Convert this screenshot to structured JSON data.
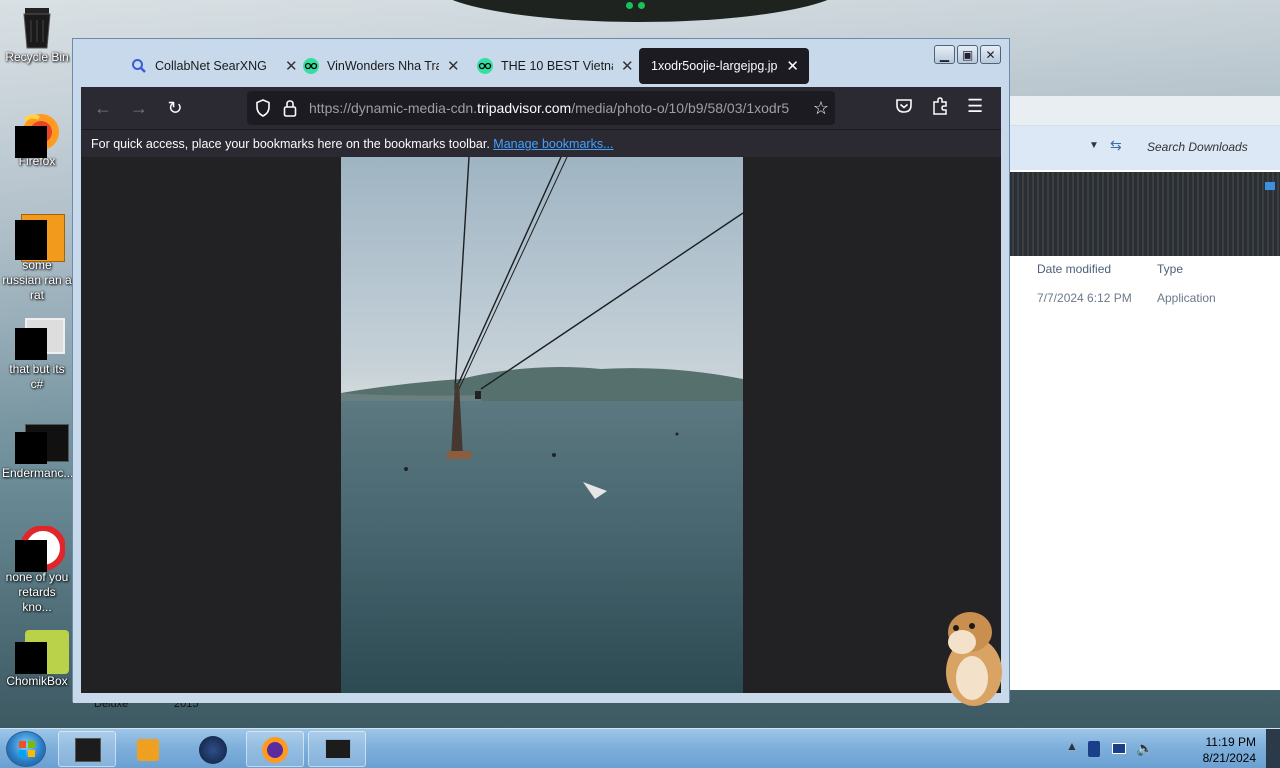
{
  "desktop": {
    "icons": [
      {
        "label": "Recycle Bin"
      },
      {
        "label": "Firefox"
      },
      {
        "label": "some russian ran a rat"
      },
      {
        "label": "that but its c#"
      },
      {
        "label": "Endermanc..."
      },
      {
        "label": "none of you retards kno..."
      },
      {
        "label": "ChomikBox"
      }
    ],
    "bottom_labels": [
      "Deluxe",
      "2015"
    ]
  },
  "explorer": {
    "search_placeholder": "Search Downloads",
    "columns": [
      "Date modified",
      "Type"
    ],
    "row": {
      "date": "7/7/2024 6:12 PM",
      "type": "Application"
    }
  },
  "browser": {
    "tabs": [
      {
        "label": "CollabNet SearXNG",
        "icon": "search-icon",
        "active": false
      },
      {
        "label": "VinWonders Nha Tran",
        "icon": "tripadvisor-icon",
        "active": false
      },
      {
        "label": "THE 10 BEST Vietnam",
        "icon": "tripadvisor-icon",
        "active": false
      },
      {
        "label": "1xodr5oojie-largejpg.jpg",
        "icon": "",
        "active": true
      }
    ],
    "url": {
      "prefix": "https://dynamic-media-cdn.",
      "domain": "tripadvisor.com",
      "path": "/media/photo-o/10/b9/58/03/1xodr5"
    },
    "bookmarks_text": "For quick access, place your bookmarks here on the bookmarks toolbar.",
    "bookmarks_link": "Manage bookmarks..."
  },
  "taskbar": {
    "time": "11:19 PM",
    "date": "8/21/2024"
  },
  "colors": {
    "browser_chrome": "#2b2a33",
    "url_field": "#1c1b22",
    "link": "#45a1ff",
    "taskbar": "#7fb0dc"
  }
}
